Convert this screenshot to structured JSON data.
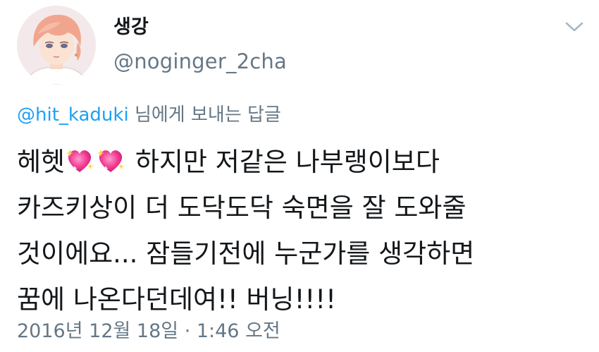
{
  "author": {
    "display_name": "생강",
    "handle": "@noginger_2cha"
  },
  "reply": {
    "mention": "@hit_kaduki",
    "suffix": " 님에게 보내는 답글"
  },
  "tweet": {
    "line1_prefix": "헤헷",
    "line1_suffix": " 하지만 저같은 나부랭이보다",
    "line2": "카즈키상이 더 도닥도닥 숙면을 잘 도와줄",
    "line3": "것이에요... 잠들기전에 누군가를 생각하면",
    "line4": "꿈에 나온다던데여!! 버닝!!!!",
    "emoji": [
      "sparkling-heart",
      "sparkling-heart"
    ]
  },
  "timestamp": "2016년 12월 18일 · 1:46 오전",
  "colors": {
    "text": "#14171a",
    "secondary": "#657786",
    "link": "#1da1f2",
    "heart": "#e8287f"
  }
}
